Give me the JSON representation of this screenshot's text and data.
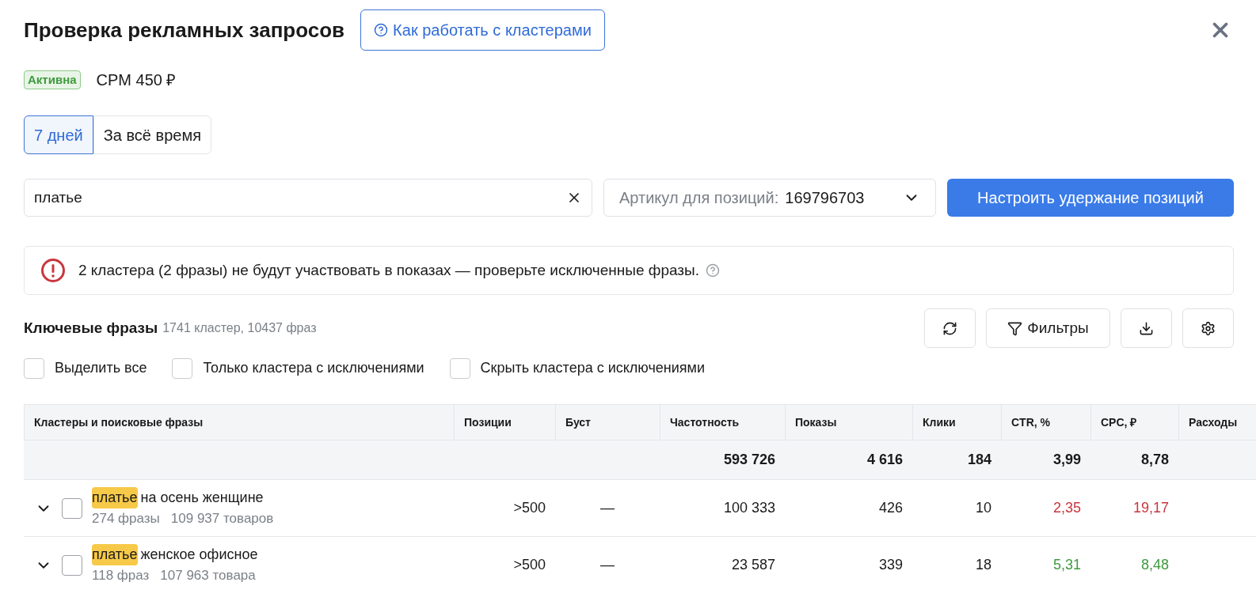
{
  "title": "Проверка рекламных запросов",
  "help_button": "Как работать с кластерами",
  "status": {
    "label": "Активна",
    "active": true
  },
  "cpm": "CPM 450 ₽",
  "period_tabs": [
    {
      "label": "7 дней",
      "selected": true
    },
    {
      "label": "За всё время",
      "selected": false
    }
  ],
  "search": {
    "value": "платье"
  },
  "article_select": {
    "label": "Артикул для позиций:",
    "value": "169796703"
  },
  "primary_button": "Настроить удержание позиций",
  "alert": {
    "text": "2 кластера (2 фразы) не будут участвовать в показах — проверьте исключенные фразы."
  },
  "section": {
    "title": "Ключевые фразы",
    "count": "1741 кластер, 10437 фраз"
  },
  "toolbar": {
    "filters_button": "Фильтры"
  },
  "checkboxes": [
    {
      "label": "Выделить все",
      "checked": false
    },
    {
      "label": "Только кластера с исключениями",
      "checked": false
    },
    {
      "label": "Скрыть кластера с исключениями",
      "checked": false
    }
  ],
  "table": {
    "columns": [
      "Кластеры и поисковые фразы",
      "Позиции",
      "Буст",
      "Частотность",
      "Показы",
      "Клики",
      "CTR, %",
      "CPC, ₽",
      "Расходы"
    ],
    "totals": {
      "frequency": "593 726",
      "impressions": "4 616",
      "clicks": "184",
      "ctr": "3,99",
      "cpc": "8,78"
    },
    "rows": [
      {
        "highlight": "платье",
        "phrase": "на осень женщине",
        "phrases_count": "274 фразы",
        "goods_count": "109 937 товаров",
        "expanded": false,
        "checked": false,
        "positions": ">500",
        "boost": "—",
        "frequency": "100 333",
        "impressions": "426",
        "clicks": "10",
        "ctr": "2,35",
        "cpc": "19,17",
        "underperforming": true
      },
      {
        "highlight": "платье",
        "phrase": "женское офисное",
        "phrases_count": "118 фраз",
        "goods_count": "107 963 товара",
        "expanded": false,
        "checked": false,
        "positions": ">500",
        "boost": "—",
        "frequency": "23 587",
        "impressions": "339",
        "clicks": "18",
        "ctr": "5,31",
        "cpc": "8,48",
        "underperforming": false
      }
    ]
  }
}
